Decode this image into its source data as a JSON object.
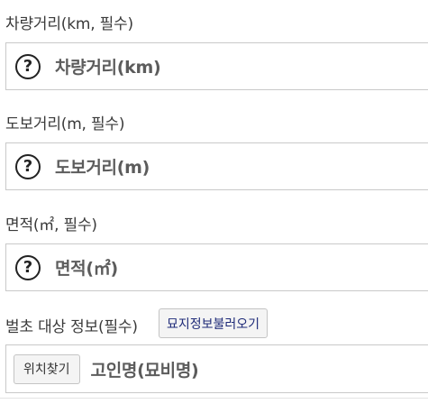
{
  "sections": [
    {
      "label": "차량거리(km, 필수)",
      "placeholder": "차량거리(km)",
      "icon": "help-circle-icon"
    },
    {
      "label": "도보거리(m, 필수)",
      "placeholder": "도보거리(m)",
      "icon": "help-circle-icon"
    },
    {
      "label": "면적(㎡, 필수)",
      "placeholder": "면적(㎡)",
      "icon": "help-circle-icon"
    }
  ],
  "help_glyph": "?",
  "grave": {
    "label": "벌초 대상 정보(필수)",
    "load_button": "묘지정보불러오기",
    "find_button": "위치찾기",
    "placeholder": "고인명(묘비명)"
  },
  "colors": {
    "border": "#c9c9c9",
    "placeholder_text": "#5c5c5c",
    "button_text_accent": "#1e2a78"
  }
}
